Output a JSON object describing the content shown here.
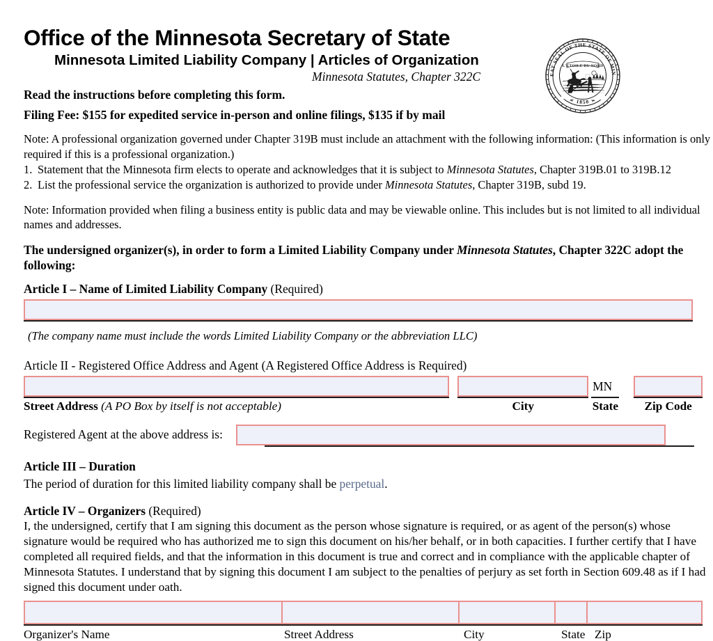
{
  "header": {
    "title": "Office of the Minnesota Secretary of State",
    "subtitle": "Minnesota Limited Liability Company | Articles of Organization",
    "statute": "Minnesota Statutes, Chapter 322C",
    "instruction": "Read the instructions before completing this form.",
    "filing_fee": "Filing Fee: $155 for expedited service in-person and online filings, $135 if by mail"
  },
  "seal": {
    "outer_text": "THE GREAT SEAL OF THE STATE OF MINNESOTA",
    "banner_text": "L'ETOILE DU NORD",
    "year": "1858"
  },
  "notes": {
    "note1": "Note:  A professional organization governed under Chapter 319B must include an attachment with the following information: (This information is only required if this is a professional organization.)",
    "item1_num": "1.",
    "item1_a": "Statement that the Minnesota firm elects to operate and acknowledges that it is subject to ",
    "item1_italic": "Minnesota Statutes",
    "item1_b": ", Chapter 319B.01 to 319B.12",
    "item2_num": "2.",
    "item2_a": "List the professional service the organization is authorized to provide under ",
    "item2_italic": "Minnesota Statutes",
    "item2_b": ", Chapter 319B, subd 19.",
    "note2": "Note: Information provided when filing a business entity is public data and may be viewable online. This includes but is not limited to all individual names and addresses."
  },
  "undersigned": {
    "part1": "The undersigned organizer(s), in order to form a Limited Liability Company under ",
    "statutes_italic": "Minnesota Statutes",
    "part2": ", Chapter 322C adopt the following:"
  },
  "article1": {
    "heading_bold": "Article I – Name of Limited Liability Company",
    "heading_plain": " (Required)",
    "value": "",
    "placeholder": "",
    "note": "(The company name must include the words Limited Liability Company or the abbreviation LLC)"
  },
  "article2": {
    "heading": "Article II - Registered Office Address and Agent (A Registered Office Address is Required)",
    "street_value": "",
    "city_value": "",
    "state_value": "MN",
    "zip_value": "",
    "label_street_bold": "Street Address",
    "label_street_italic": " (A PO Box by itself is not acceptable)",
    "label_city": "City",
    "label_state": "State",
    "label_zip": "Zip Code",
    "agent_label": "Registered Agent at the above address is:",
    "agent_value": ""
  },
  "article3": {
    "heading": "Article III – Duration",
    "text_before": "The period of duration for this limited liability company shall be ",
    "duration_value": "perpetual",
    "text_after": "."
  },
  "article4": {
    "heading_bold": "Article IV – Organizers",
    "heading_plain": " (Required)",
    "paragraph": "I, the undersigned, certify that I am signing this document as the person whose signature is required, or as agent of the person(s) whose signature would be required who has authorized me to sign this document on his/her behalf, or in both capacities.  I further certify that I have completed all required fields, and that the information in this document is true and correct and in compliance with the applicable chapter of Minnesota Statutes.  I understand that by signing this document I am subject to the penalties of perjury as set forth in Section 609.48 as if I had signed this document under oath.",
    "columns": [
      {
        "label": "Organizer's Name",
        "value": ""
      },
      {
        "label": "Street Address",
        "value": ""
      },
      {
        "label": "City",
        "value": ""
      },
      {
        "label": "State",
        "value": ""
      },
      {
        "label": "Zip",
        "value": ""
      }
    ]
  },
  "colors": {
    "field_border": "#ea908e",
    "field_fill": "#eef0fa",
    "rule": "#1a1a1a",
    "value_text": "#5b6b8c"
  }
}
